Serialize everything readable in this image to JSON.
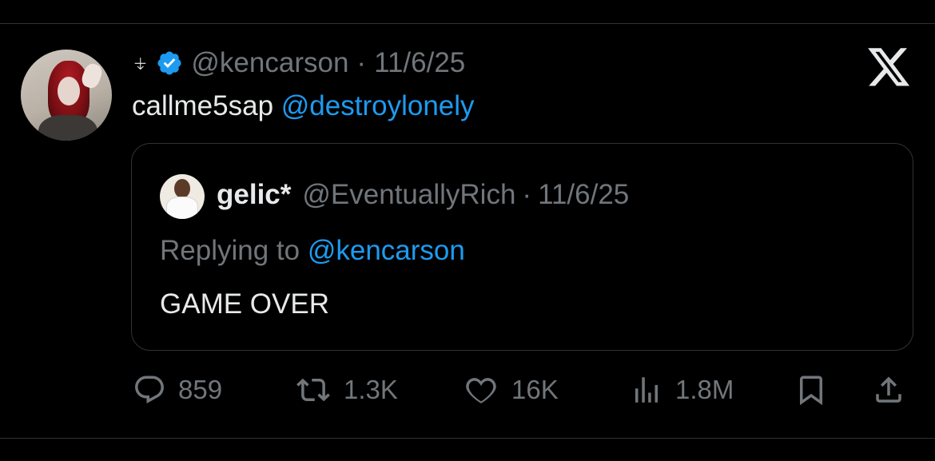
{
  "tweet": {
    "display_name": "⍖",
    "handle": "@kencarson",
    "separator": "·",
    "date": "11/6/25",
    "text": "callme5sap",
    "mention": "@destroylonely"
  },
  "quoted": {
    "display_name": "gelic*",
    "handle": "@EventuallyRich",
    "separator": "·",
    "date": "11/6/25",
    "replying_prefix": "Replying to",
    "replying_handle": "@kencarson",
    "text": "GAME OVER"
  },
  "actions": {
    "replies": "859",
    "reposts": "1.3K",
    "likes": "16K",
    "views": "1.8M"
  },
  "icons": {
    "verified": "verified-badge-icon",
    "x_logo": "x-logo-icon",
    "reply": "reply-icon",
    "repost": "repost-icon",
    "like": "heart-icon",
    "views": "views-icon",
    "bookmark": "bookmark-icon",
    "share": "share-icon"
  },
  "colors": {
    "background": "#000000",
    "text": "#e7e9ea",
    "secondary": "#71767b",
    "accent": "#1d9bf0",
    "border": "#2f3336"
  }
}
